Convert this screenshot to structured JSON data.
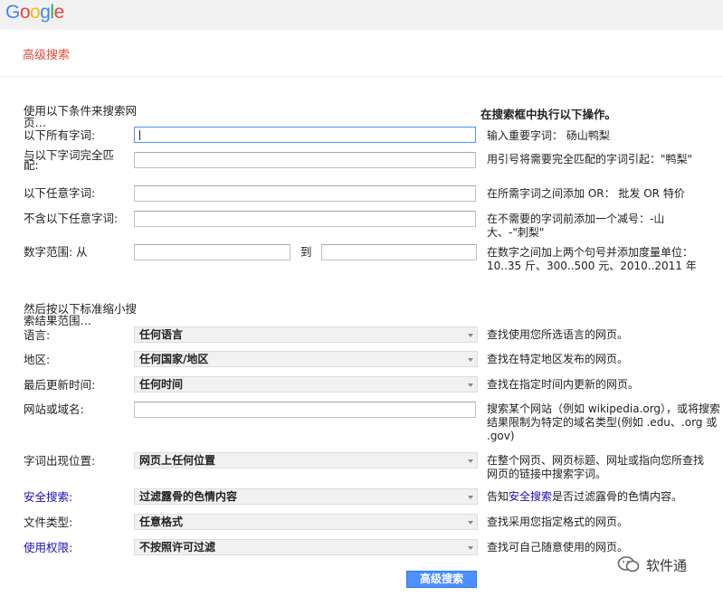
{
  "logo": {
    "letters": [
      "G",
      "o",
      "o",
      "g",
      "l",
      "e"
    ],
    "colors": [
      "#4285f4",
      "#ea4335",
      "#fbbc05",
      "#4285f4",
      "#34a853",
      "#ea4335"
    ]
  },
  "page_title": "高级搜索",
  "section1": {
    "heading": "使用以下条件来搜索网页…",
    "right_heading": "在搜索框中执行以下操作。",
    "rows": [
      {
        "label": "以下所有字词:",
        "value": "",
        "hint": "输入重要字词： 砀山鸭梨"
      },
      {
        "label": "与以下字词完全匹配:",
        "value": "",
        "hint": "用引号将需要完全匹配的字词引起：\"鸭梨\""
      },
      {
        "label": "以下任意字词:",
        "value": "",
        "hint": "在所需字词之间添加 OR： 批发 OR 特价"
      },
      {
        "label": "不含以下任意字词:",
        "value": "",
        "hint": "在不需要的字词前添加一个减号：-山大、-\"刺梨\""
      }
    ],
    "range": {
      "label": "数字范围: 从",
      "to": "到",
      "hint": "在数字之间加上两个句号并添加度量单位：10..35 斤、300..500 元、2010..2011 年"
    }
  },
  "section2": {
    "heading": "然后按以下标准缩小搜索结果范围…",
    "language": {
      "label": "语言:",
      "value": "任何语言",
      "hint": "查找使用您所选语言的网页。"
    },
    "region": {
      "label": "地区:",
      "value": "任何国家/地区",
      "hint": "查找在特定地区发布的网页。"
    },
    "updated": {
      "label": "最后更新时间:",
      "value": "任何时间",
      "hint": "查找在指定时间内更新的网页。"
    },
    "site": {
      "label": "网站或域名:",
      "value": "",
      "hint": "搜索某个网站（例如 wikipedia.org），或将搜索结果限制为特定的域名类型(例如 .edu、.org 或 .gov)"
    },
    "terms": {
      "label": "字词出现位置:",
      "value": "网页上任何位置",
      "hint": "在整个网页、网页标题、网址或指向您所查找网页的链接中搜索字词。"
    },
    "safe": {
      "label": "安全搜索:",
      "value": "过滤露骨的色情内容",
      "hint_pre": "告知",
      "hint_link": "安全搜索",
      "hint_post": "是否过滤露骨的色情内容。"
    },
    "filetype": {
      "label": "文件类型:",
      "value": "任意格式",
      "hint": "查找采用您指定格式的网页。"
    },
    "rights": {
      "label": "使用权限:",
      "value": "不按照许可过滤",
      "hint": "查找可自己随意使用的网页。"
    }
  },
  "submit_label": "高级搜索",
  "watermark": "软件通"
}
